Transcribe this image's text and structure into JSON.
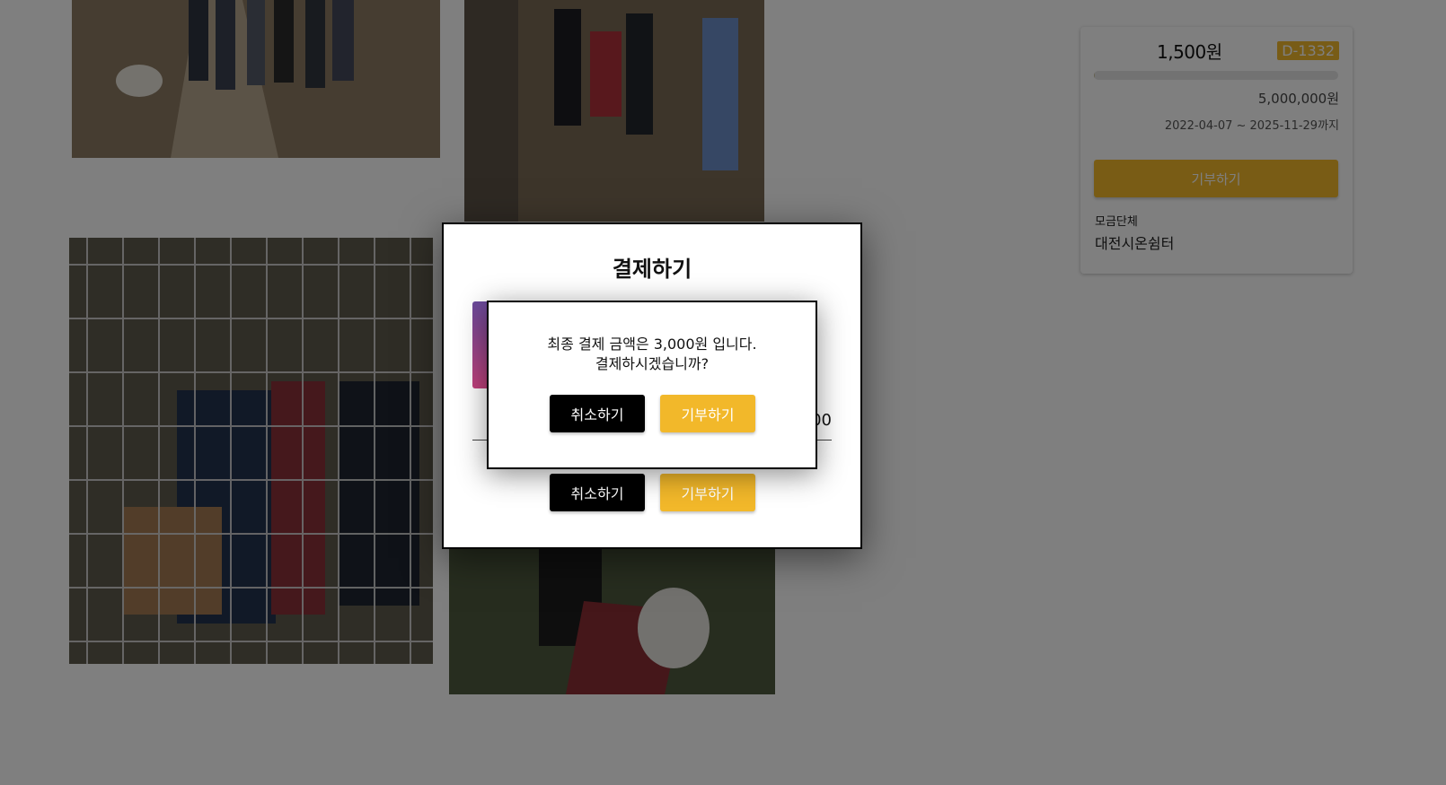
{
  "campaign": {
    "raised_amount": "1,500원",
    "d_day": "D-1332",
    "progress_fraction": 0.0003,
    "goal_amount": "5,000,000원",
    "period": "2022-04-07 ~ 2025-11-29까지",
    "donate_label": "기부하기",
    "org_label": "모금단체",
    "org_name": "대전시온쉼터"
  },
  "payment_modal": {
    "title": "결제하기",
    "amount_partial": "00",
    "cancel_label": "취소하기",
    "donate_label": "기부하기"
  },
  "confirm_dialog": {
    "message_line1": "최종 결제 금액은 3,000원 입니다.",
    "message_line2": "결제하시겠습니까?",
    "cancel_label": "취소하기",
    "donate_label": "기부하기"
  },
  "colors": {
    "accent": "#f2b82a",
    "dark_button": "#000000",
    "overlay": "rgba(0,0,0,0.5)"
  }
}
